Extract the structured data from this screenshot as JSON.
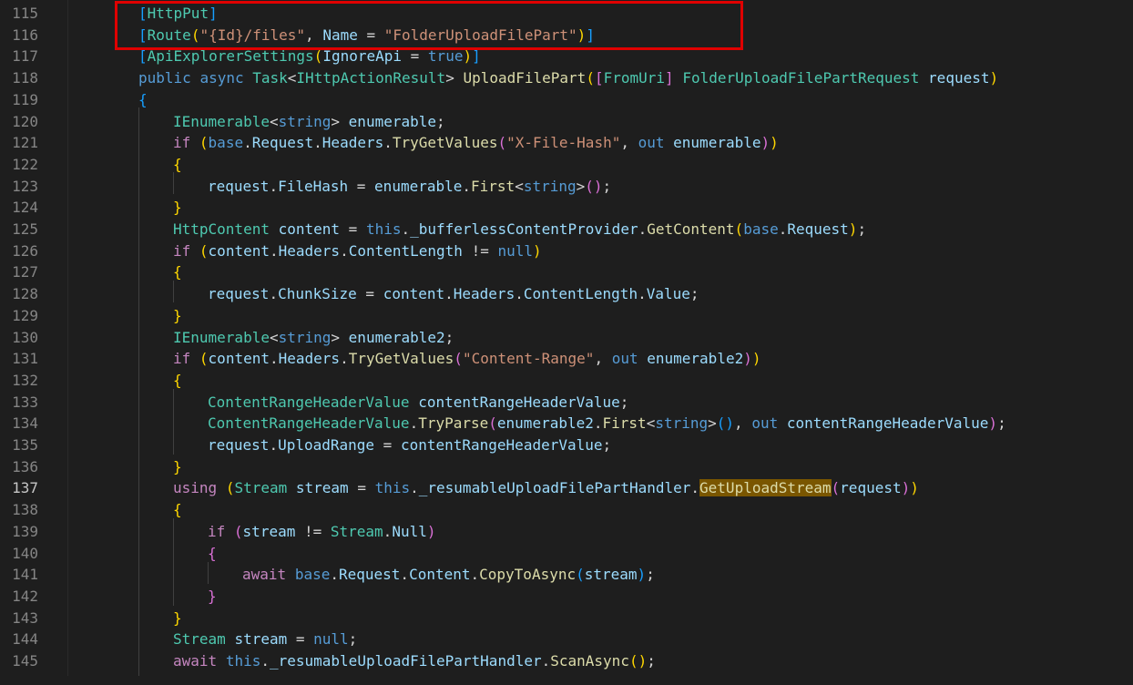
{
  "editor": {
    "active_line": "137",
    "lines": [
      {
        "n": "115",
        "indent": 152,
        "tokens": [
          [
            "b3",
            "["
          ],
          [
            "type",
            "HttpPut"
          ],
          [
            "b3",
            "]"
          ]
        ]
      },
      {
        "n": "116",
        "indent": 152,
        "tokens": [
          [
            "b3",
            "["
          ],
          [
            "type",
            "Route"
          ],
          [
            "b1",
            "("
          ],
          [
            "str",
            "\"{Id}/files\""
          ],
          [
            "plain",
            ", "
          ],
          [
            "var",
            "Name"
          ],
          [
            "plain",
            " = "
          ],
          [
            "str",
            "\"FolderUploadFilePart\""
          ],
          [
            "b1",
            ")"
          ],
          [
            "b3",
            "]"
          ]
        ]
      },
      {
        "n": "117",
        "indent": 152,
        "tokens": [
          [
            "b3",
            "["
          ],
          [
            "type",
            "ApiExplorerSettings"
          ],
          [
            "b1",
            "("
          ],
          [
            "var",
            "IgnoreApi"
          ],
          [
            "plain",
            " = "
          ],
          [
            "kw",
            "true"
          ],
          [
            "b1",
            ")"
          ],
          [
            "b3",
            "]"
          ]
        ]
      },
      {
        "n": "118",
        "indent": 152,
        "tokens": [
          [
            "kw",
            "public"
          ],
          [
            "plain",
            " "
          ],
          [
            "kw",
            "async"
          ],
          [
            "plain",
            " "
          ],
          [
            "type",
            "Task"
          ],
          [
            "plain",
            "<"
          ],
          [
            "type",
            "IHttpActionResult"
          ],
          [
            "plain",
            "> "
          ],
          [
            "method",
            "UploadFilePart"
          ],
          [
            "b1",
            "("
          ],
          [
            "b2",
            "["
          ],
          [
            "type",
            "FromUri"
          ],
          [
            "b2",
            "]"
          ],
          [
            "plain",
            " "
          ],
          [
            "type",
            "FolderUploadFilePartRequest"
          ],
          [
            "plain",
            " "
          ],
          [
            "var",
            "request"
          ],
          [
            "b1",
            ")"
          ]
        ]
      },
      {
        "n": "119",
        "indent": 152,
        "tokens": [
          [
            "b3",
            "{"
          ]
        ]
      },
      {
        "n": "120",
        "indent": 190,
        "tokens": [
          [
            "type",
            "IEnumerable"
          ],
          [
            "plain",
            "<"
          ],
          [
            "kw",
            "string"
          ],
          [
            "plain",
            "> "
          ],
          [
            "var",
            "enumerable"
          ],
          [
            "plain",
            ";"
          ]
        ]
      },
      {
        "n": "121",
        "indent": 190,
        "tokens": [
          [
            "ctrl",
            "if"
          ],
          [
            "plain",
            " "
          ],
          [
            "b1",
            "("
          ],
          [
            "kw",
            "base"
          ],
          [
            "plain",
            "."
          ],
          [
            "var",
            "Request"
          ],
          [
            "plain",
            "."
          ],
          [
            "var",
            "Headers"
          ],
          [
            "plain",
            "."
          ],
          [
            "method",
            "TryGetValues"
          ],
          [
            "b2",
            "("
          ],
          [
            "str",
            "\"X-File-Hash\""
          ],
          [
            "plain",
            ", "
          ],
          [
            "kw",
            "out"
          ],
          [
            "plain",
            " "
          ],
          [
            "var",
            "enumerable"
          ],
          [
            "b2",
            ")"
          ],
          [
            "b1",
            ")"
          ]
        ]
      },
      {
        "n": "122",
        "indent": 190,
        "tokens": [
          [
            "b1",
            "{"
          ]
        ]
      },
      {
        "n": "123",
        "indent": 228,
        "tokens": [
          [
            "var",
            "request"
          ],
          [
            "plain",
            "."
          ],
          [
            "var",
            "FileHash"
          ],
          [
            "plain",
            " = "
          ],
          [
            "var",
            "enumerable"
          ],
          [
            "plain",
            "."
          ],
          [
            "method",
            "First"
          ],
          [
            "plain",
            "<"
          ],
          [
            "kw",
            "string"
          ],
          [
            "plain",
            ">"
          ],
          [
            "b2",
            "("
          ],
          [
            "b2",
            ")"
          ],
          [
            "plain",
            ";"
          ]
        ]
      },
      {
        "n": "124",
        "indent": 190,
        "tokens": [
          [
            "b1",
            "}"
          ]
        ]
      },
      {
        "n": "125",
        "indent": 190,
        "tokens": [
          [
            "type",
            "HttpContent"
          ],
          [
            "plain",
            " "
          ],
          [
            "var",
            "content"
          ],
          [
            "plain",
            " = "
          ],
          [
            "kw",
            "this"
          ],
          [
            "plain",
            "."
          ],
          [
            "var",
            "_bufferlessContentProvider"
          ],
          [
            "plain",
            "."
          ],
          [
            "method",
            "GetContent"
          ],
          [
            "b1",
            "("
          ],
          [
            "kw",
            "base"
          ],
          [
            "plain",
            "."
          ],
          [
            "var",
            "Request"
          ],
          [
            "b1",
            ")"
          ],
          [
            "plain",
            ";"
          ]
        ]
      },
      {
        "n": "126",
        "indent": 190,
        "tokens": [
          [
            "ctrl",
            "if"
          ],
          [
            "plain",
            " "
          ],
          [
            "b1",
            "("
          ],
          [
            "var",
            "content"
          ],
          [
            "plain",
            "."
          ],
          [
            "var",
            "Headers"
          ],
          [
            "plain",
            "."
          ],
          [
            "var",
            "ContentLength"
          ],
          [
            "plain",
            " != "
          ],
          [
            "kw",
            "null"
          ],
          [
            "b1",
            ")"
          ]
        ]
      },
      {
        "n": "127",
        "indent": 190,
        "tokens": [
          [
            "b1",
            "{"
          ]
        ]
      },
      {
        "n": "128",
        "indent": 228,
        "tokens": [
          [
            "var",
            "request"
          ],
          [
            "plain",
            "."
          ],
          [
            "var",
            "ChunkSize"
          ],
          [
            "plain",
            " = "
          ],
          [
            "var",
            "content"
          ],
          [
            "plain",
            "."
          ],
          [
            "var",
            "Headers"
          ],
          [
            "plain",
            "."
          ],
          [
            "var",
            "ContentLength"
          ],
          [
            "plain",
            "."
          ],
          [
            "var",
            "Value"
          ],
          [
            "plain",
            ";"
          ]
        ]
      },
      {
        "n": "129",
        "indent": 190,
        "tokens": [
          [
            "b1",
            "}"
          ]
        ]
      },
      {
        "n": "130",
        "indent": 190,
        "tokens": [
          [
            "type",
            "IEnumerable"
          ],
          [
            "plain",
            "<"
          ],
          [
            "kw",
            "string"
          ],
          [
            "plain",
            "> "
          ],
          [
            "var",
            "enumerable2"
          ],
          [
            "plain",
            ";"
          ]
        ]
      },
      {
        "n": "131",
        "indent": 190,
        "tokens": [
          [
            "ctrl",
            "if"
          ],
          [
            "plain",
            " "
          ],
          [
            "b1",
            "("
          ],
          [
            "var",
            "content"
          ],
          [
            "plain",
            "."
          ],
          [
            "var",
            "Headers"
          ],
          [
            "plain",
            "."
          ],
          [
            "method",
            "TryGetValues"
          ],
          [
            "b2",
            "("
          ],
          [
            "str",
            "\"Content-Range\""
          ],
          [
            "plain",
            ", "
          ],
          [
            "kw",
            "out"
          ],
          [
            "plain",
            " "
          ],
          [
            "var",
            "enumerable2"
          ],
          [
            "b2",
            ")"
          ],
          [
            "b1",
            ")"
          ]
        ]
      },
      {
        "n": "132",
        "indent": 190,
        "tokens": [
          [
            "b1",
            "{"
          ]
        ]
      },
      {
        "n": "133",
        "indent": 228,
        "tokens": [
          [
            "type",
            "ContentRangeHeaderValue"
          ],
          [
            "plain",
            " "
          ],
          [
            "var",
            "contentRangeHeaderValue"
          ],
          [
            "plain",
            ";"
          ]
        ]
      },
      {
        "n": "134",
        "indent": 228,
        "tokens": [
          [
            "type",
            "ContentRangeHeaderValue"
          ],
          [
            "plain",
            "."
          ],
          [
            "method",
            "TryParse"
          ],
          [
            "b2",
            "("
          ],
          [
            "var",
            "enumerable2"
          ],
          [
            "plain",
            "."
          ],
          [
            "method",
            "First"
          ],
          [
            "plain",
            "<"
          ],
          [
            "kw",
            "string"
          ],
          [
            "plain",
            ">"
          ],
          [
            "b3",
            "("
          ],
          [
            "b3",
            ")"
          ],
          [
            "plain",
            ", "
          ],
          [
            "kw",
            "out"
          ],
          [
            "plain",
            " "
          ],
          [
            "var",
            "contentRangeHeaderValue"
          ],
          [
            "b2",
            ")"
          ],
          [
            "plain",
            ";"
          ]
        ]
      },
      {
        "n": "135",
        "indent": 228,
        "tokens": [
          [
            "var",
            "request"
          ],
          [
            "plain",
            "."
          ],
          [
            "var",
            "UploadRange"
          ],
          [
            "plain",
            " = "
          ],
          [
            "var",
            "contentRangeHeaderValue"
          ],
          [
            "plain",
            ";"
          ]
        ]
      },
      {
        "n": "136",
        "indent": 190,
        "tokens": [
          [
            "b1",
            "}"
          ]
        ]
      },
      {
        "n": "137",
        "indent": 190,
        "tokens": [
          [
            "ctrl",
            "using"
          ],
          [
            "plain",
            " "
          ],
          [
            "b1",
            "("
          ],
          [
            "type",
            "Stream"
          ],
          [
            "plain",
            " "
          ],
          [
            "var",
            "stream"
          ],
          [
            "plain",
            " = "
          ],
          [
            "kw",
            "this"
          ],
          [
            "plain",
            "."
          ],
          [
            "var",
            "_resumableUploadFilePartHandler"
          ],
          [
            "plain",
            "."
          ],
          [
            "hl",
            "GetUploadStream"
          ],
          [
            "b2",
            "("
          ],
          [
            "var",
            "request"
          ],
          [
            "b2",
            ")"
          ],
          [
            "b1",
            ")"
          ]
        ]
      },
      {
        "n": "138",
        "indent": 190,
        "tokens": [
          [
            "b1",
            "{"
          ]
        ]
      },
      {
        "n": "139",
        "indent": 228,
        "tokens": [
          [
            "ctrl",
            "if"
          ],
          [
            "plain",
            " "
          ],
          [
            "b2",
            "("
          ],
          [
            "var",
            "stream"
          ],
          [
            "plain",
            " != "
          ],
          [
            "type",
            "Stream"
          ],
          [
            "plain",
            "."
          ],
          [
            "var",
            "Null"
          ],
          [
            "b2",
            ")"
          ]
        ]
      },
      {
        "n": "140",
        "indent": 228,
        "tokens": [
          [
            "b2",
            "{"
          ]
        ]
      },
      {
        "n": "141",
        "indent": 266,
        "tokens": [
          [
            "ctrl",
            "await"
          ],
          [
            "plain",
            " "
          ],
          [
            "kw",
            "base"
          ],
          [
            "plain",
            "."
          ],
          [
            "var",
            "Request"
          ],
          [
            "plain",
            "."
          ],
          [
            "var",
            "Content"
          ],
          [
            "plain",
            "."
          ],
          [
            "method",
            "CopyToAsync"
          ],
          [
            "b3",
            "("
          ],
          [
            "var",
            "stream"
          ],
          [
            "b3",
            ")"
          ],
          [
            "plain",
            ";"
          ]
        ]
      },
      {
        "n": "142",
        "indent": 228,
        "tokens": [
          [
            "b2",
            "}"
          ]
        ]
      },
      {
        "n": "143",
        "indent": 190,
        "tokens": [
          [
            "b1",
            "}"
          ]
        ]
      },
      {
        "n": "144",
        "indent": 190,
        "tokens": [
          [
            "type",
            "Stream"
          ],
          [
            "plain",
            " "
          ],
          [
            "var",
            "stream"
          ],
          [
            "plain",
            " = "
          ],
          [
            "kw",
            "null"
          ],
          [
            "plain",
            ";"
          ]
        ]
      },
      {
        "n": "145",
        "indent": 190,
        "tokens": [
          [
            "ctrl",
            "await"
          ],
          [
            "plain",
            " "
          ],
          [
            "kw",
            "this"
          ],
          [
            "plain",
            "."
          ],
          [
            "var",
            "_resumableUploadFilePartHandler"
          ],
          [
            "plain",
            "."
          ],
          [
            "method",
            "ScanAsync"
          ],
          [
            "b1",
            "("
          ],
          [
            "b1",
            ")"
          ],
          [
            "plain",
            ";"
          ]
        ]
      }
    ]
  }
}
